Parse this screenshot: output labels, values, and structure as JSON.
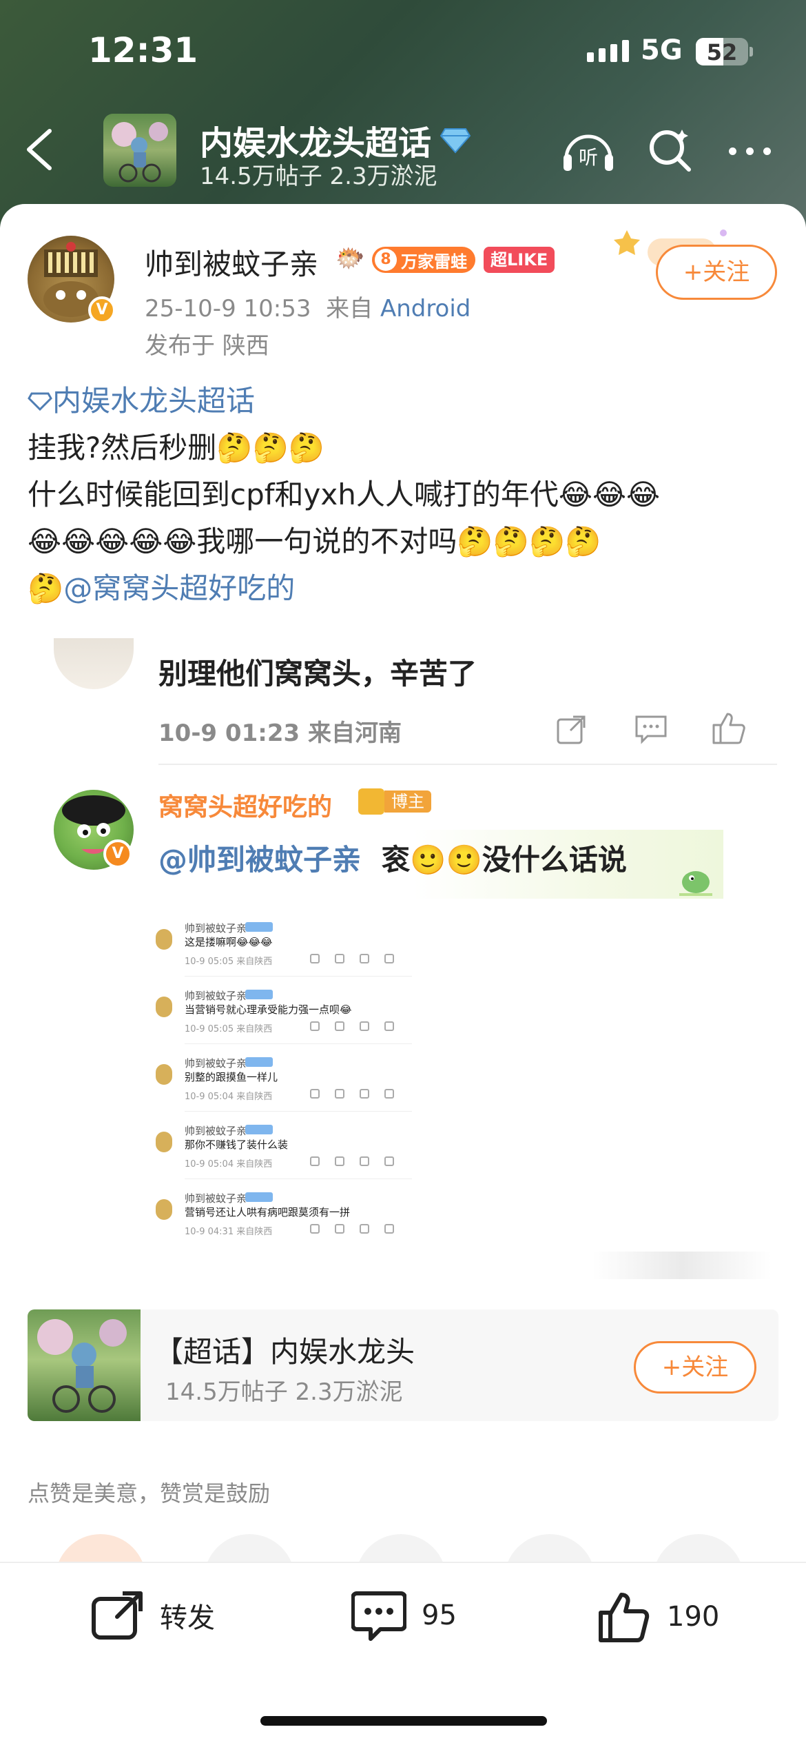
{
  "status_bar": {
    "time": "12:31",
    "network": "5G",
    "battery": "52",
    "battery_level": 0.52
  },
  "header": {
    "topic_name": "内娱水龙头超话",
    "topic_stats": "14.5万帖子 2.3万淤泥"
  },
  "post": {
    "author_name": "帅到被蚊子亲",
    "level": "8",
    "fan_badge": "万家雷蛙",
    "like_badge": "超LIKE",
    "verified_mark": "V",
    "time": "25-10-9 10:53",
    "source_prefix": "来自",
    "source_os": "Android",
    "location": "发布于 陕西",
    "follow_label": "+关注",
    "topic_link": "内娱水龙头超话",
    "line1": "挂我?然后秒删",
    "line2": "什么时候能回到cpf和yxh人人喊打的年代",
    "line3": "我哪一句说的不对吗",
    "mention": "@窝窝头超好吃的"
  },
  "screenshot": {
    "comment1_text": "别理他们窝窝头，辛苦了",
    "comment1_meta": "10-9 01:23 来自河南",
    "reply_name": "窝窝头超好吃的",
    "reply_owner_badge": "博主",
    "reply_verified_mark": "V",
    "reply_mention": "@帅到被蚊子亲",
    "reply_text_a": "衮",
    "reply_text_b": "没什么话说",
    "mini_items": [
      {
        "name": "帅到被蚊子亲",
        "text": "这是搂嘛啊😂😂😂",
        "meta": "10-9 05:05 来自陕西"
      },
      {
        "name": "帅到被蚊子亲",
        "text": "当营销号就心理承受能力强一点呗😂",
        "meta": "10-9 05:05 来自陕西"
      },
      {
        "name": "帅到被蚊子亲",
        "text": "别整的跟摸鱼一样儿",
        "meta": "10-9 05:04 来自陕西"
      },
      {
        "name": "帅到被蚊子亲",
        "text": "那你不赚钱了装什么装",
        "meta": "10-9 05:04 来自陕西"
      },
      {
        "name": "帅到被蚊子亲",
        "text": "营销号还让人哄有病吧跟莫须有一拼",
        "meta": "10-9 04:31 来自陕西"
      }
    ]
  },
  "topic_card": {
    "title": "【超话】内娱水龙头",
    "stats": "14.5万帖子 2.3万淤泥",
    "follow_label": "+关注"
  },
  "reward_hint": "点赞是美意，赞赏是鼓励",
  "bottom_bar": {
    "repost_label": "转发",
    "comment_count": "95",
    "like_count": "190"
  },
  "colors": {
    "accent": "#f7893a",
    "link": "#4f7db3",
    "header_bg": "#2f4b3a"
  }
}
